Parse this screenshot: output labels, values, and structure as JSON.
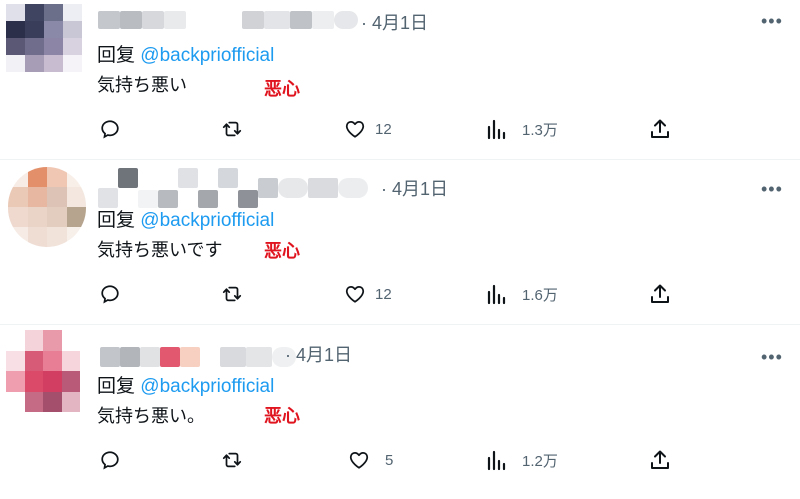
{
  "colors": {
    "handle": "#1d9bf0",
    "text": "#0f1419",
    "muted": "#536471",
    "annotation": "#e0141e",
    "separator": "#eff3f4"
  },
  "tweets": [
    {
      "date": "· 4月1日",
      "reply_prefix": "回复 ",
      "reply_handle": "@backpriofficial",
      "text": "気持ち悪い",
      "annotation": "恶心",
      "likes": "12",
      "views": "1.3万"
    },
    {
      "date": "· 4月1日",
      "reply_prefix": "回复 ",
      "reply_handle": "@backpriofficial",
      "text": "気持ち悪いです",
      "annotation": "恶心",
      "likes": "12",
      "views": "1.6万"
    },
    {
      "date": "· 4月1日",
      "reply_prefix": "回复 ",
      "reply_handle": "@backpriofficial",
      "text": "気持ち悪い。",
      "annotation": "恶心",
      "likes": "5",
      "views": "1.2万"
    }
  ]
}
